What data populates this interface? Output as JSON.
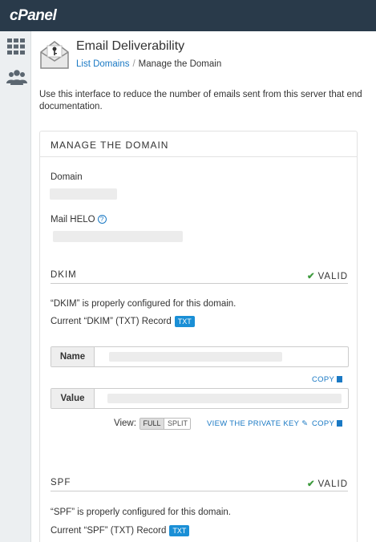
{
  "app": {
    "logo_text": "cPanel"
  },
  "header": {
    "title": "Email Deliverability",
    "breadcrumb_link": "List Domains",
    "breadcrumb_sep": "/",
    "breadcrumb_current": "Manage the Domain"
  },
  "intro": "Use this interface to reduce the number of emails sent from this server that end documentation.",
  "panel": {
    "title": "MANAGE THE DOMAIN",
    "domain_label": "Domain",
    "mail_helo_label": "Mail HELO",
    "help_glyph": "?"
  },
  "dkim": {
    "title": "DKIM",
    "status": "VALID",
    "configured_text": "“DKIM” is properly configured for this domain.",
    "record_text": "Current “DKIM” (TXT) Record",
    "badge": "TXT",
    "name_label": "Name",
    "value_label": "Value",
    "copy_label": "COPY",
    "view_label": "View:",
    "view_full": "FULL",
    "view_split": "SPLIT",
    "private_key_label": "VIEW THE PRIVATE KEY"
  },
  "spf": {
    "title": "SPF",
    "status": "VALID",
    "configured_text": "“SPF” is properly configured for this domain.",
    "record_text": "Current “SPF” (TXT) Record",
    "badge": "TXT"
  },
  "colors": {
    "topbar": "#293a4a",
    "link": "#1a79c4",
    "badge": "#1a8fd6",
    "valid_check": "#3d9a3d"
  },
  "icons": [
    "grid-icon",
    "users-icon",
    "envelope-key-icon",
    "help-icon",
    "check-icon",
    "copy-icon",
    "pencil-icon"
  ]
}
